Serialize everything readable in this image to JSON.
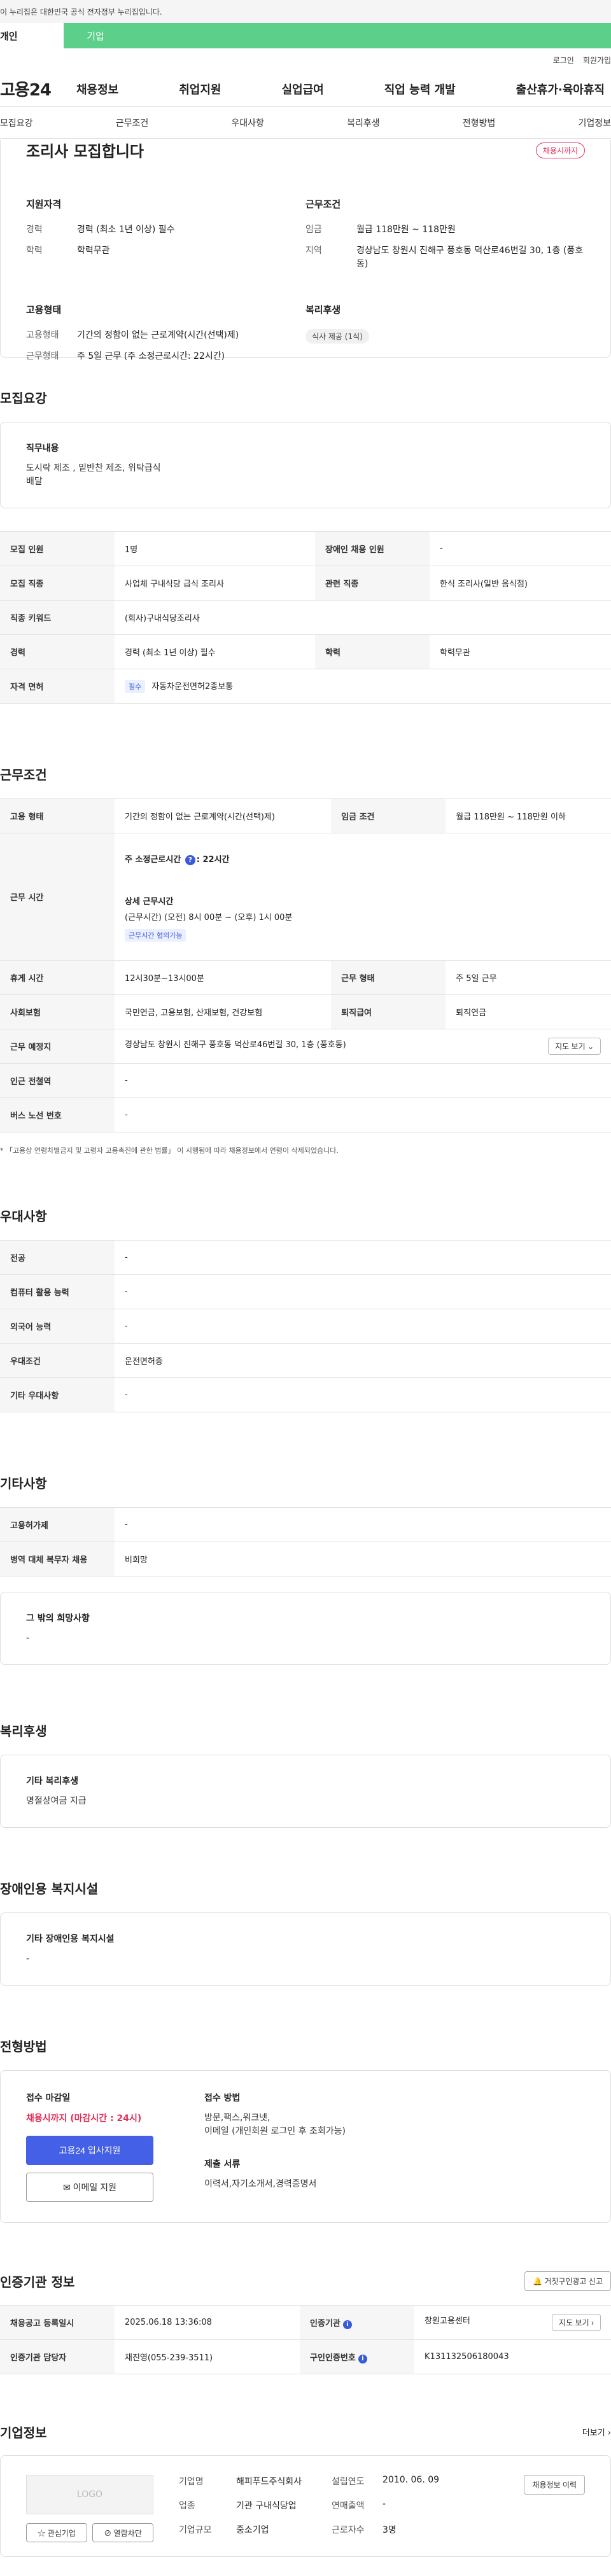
{
  "gov_banner": "이 누리집은 대한민국 공식 전자정부 누리집입니다.",
  "audience_tabs": [
    "개인",
    "기업"
  ],
  "util_links": [
    "로그인",
    "회원가입"
  ],
  "logo": "고용24",
  "gnb": [
    "채용정보",
    "취업지원",
    "실업급여",
    "직업 능력 개발",
    "출산휴가·육아휴직"
  ],
  "subnav": [
    "모집요강",
    "근무조건",
    "우대사항",
    "복리후생",
    "전형방법",
    "기업정보"
  ],
  "hero": {
    "title": "조리사 모집합니다",
    "deadline_badge": "채용시까지",
    "qual_title": "지원자격",
    "qual": [
      {
        "k": "경력",
        "v": "경력 (최소 1년 이상) 필수"
      },
      {
        "k": "학력",
        "v": "학력무관"
      }
    ],
    "cond_title": "근무조건",
    "cond": [
      {
        "k": "임금",
        "v": "월급 118만원 ~ 118만원"
      },
      {
        "k": "지역",
        "v": "경상남도 창원시 진해구 풍호동 덕산로46번길 30, 1층 (풍호동)"
      }
    ],
    "emp_title": "고용형태",
    "emp": [
      {
        "k": "고용형태",
        "v": "기간의 정함이 없는 근로계약(시간(선택)제)"
      },
      {
        "k": "근무형태",
        "v": "주 5일 근무 (주 소정근로시간: 22시간)"
      }
    ],
    "welfare_title": "복리후생",
    "welfare_tag": "식사 제공 (1식)"
  },
  "recruit": {
    "section_title": "모집요강",
    "job_label": "직무내용",
    "job_text1": "도시락 제조 , 밑반찬 제조, 위탁급식",
    "job_text2": "배달",
    "rows": {
      "r1": [
        "모집 인원",
        "1명",
        "장애인 채용 인원",
        "-"
      ],
      "r2": [
        "모집 직종",
        "사업체 구내식당 급식 조리사",
        "관련 직종",
        "한식 조리사(일반 음식점)"
      ],
      "r3": [
        "직종 키워드",
        "(회사)구내식당조리사"
      ],
      "r4": [
        "경력",
        "경력 (최소 1년 이상) 필수",
        "학력",
        "학력무관"
      ],
      "r5": [
        "자격 면허",
        "필수",
        "자동차운전면허2종보통"
      ]
    }
  },
  "work": {
    "section_title": "근무조건",
    "r1": [
      "고용 형태",
      "기간의 정함이 없는 근로계약(시간(선택)제)",
      "임금 조건",
      "월급 118만원 ~ 118만원 이하"
    ],
    "r2_label": "근무 시간",
    "weekly_label": "주 소정근로시간",
    "weekly_value": ": 22시간",
    "detail_label": "상세 근무시간",
    "detail_value": "(근무시간) (오전) 8시 00분 ~ (오후) 1시 00분",
    "detail_tag": "근무시간 협의가능",
    "r3": [
      "휴게 시간",
      "12시30분~13시00분",
      "근무 형태",
      "주 5일 근무"
    ],
    "r4": [
      "사회보험",
      "국민연금, 고용보험, 산재보험, 건강보험",
      "퇴직급여",
      "퇴직연금"
    ],
    "r5": [
      "근무 예정지",
      "경상남도 창원시 진해구 풍호동 덕산로46번길 30, 1층 (풍호동)"
    ],
    "map_btn": "지도 보기 ⌄",
    "r6": [
      "인근 전철역",
      "-"
    ],
    "r7": [
      "버스 노선 번호",
      "-"
    ],
    "note": "* 「고용상 연령차별금지 및 고령자 고용촉진에 관한 법률」 이 시행됨에 따라 채용정보에서 연령이 삭제되었습니다."
  },
  "pref": {
    "section_title": "우대사항",
    "rows": [
      [
        "전공",
        "-"
      ],
      [
        "컴퓨터 활용 능력",
        "-"
      ],
      [
        "외국어 능력",
        "-"
      ],
      [
        "우대조건",
        "운전면허증"
      ],
      [
        "기타 우대사항",
        "-"
      ]
    ]
  },
  "etc": {
    "section_title": "기타사항",
    "rows": [
      [
        "고용허가제",
        "-"
      ],
      [
        "병역 대체 복무자 채용",
        "비희망"
      ]
    ],
    "box_label": "그 밖의 희망사항",
    "box_text": "-"
  },
  "welfare": {
    "section_title": "복리후생",
    "box_label": "기타 복리후생",
    "box_text": "명절상여금 지급"
  },
  "disabled": {
    "section_title": "장애인용 복지시설",
    "box_label": "기타 장애인용 복지시설",
    "box_text": "-"
  },
  "selection": {
    "section_title": "전형방법",
    "deadline_label": "접수 마감일",
    "deadline_value": "채용시까지 (마감시간 : 24시)",
    "apply_btn": "고용24 입사지원",
    "email_btn": "이메일 지원",
    "method_label": "접수 방법",
    "method_text1": "방문,팩스,워크넷,",
    "method_text2": "이메일 (개인회원 로그인 후 조회가능)",
    "docs_label": "제출 서류",
    "docs_text": "이력서,자기소개서,경력증명서"
  },
  "cert": {
    "section_title": "인증기관 정보",
    "report_btn": "거짓구인광고 신고",
    "r1": [
      "채용공고 등록일시",
      "2025.06.18 13:36:08",
      "인증기관",
      "창원고용센터"
    ],
    "map_btn": "지도 보기 ›",
    "r2": [
      "인증기관 담당자",
      "채진영(055-239-3511)",
      "구인인증번호",
      "K131132506180043"
    ]
  },
  "company": {
    "section_title": "기업정보",
    "more": "더보기 ›",
    "logo": "LOGO",
    "fav_btn": "관심기업",
    "block_btn": "열람차단",
    "history_btn": "채용정보 이력",
    "fields": [
      [
        "기업명",
        "해피푸드주식회사",
        "설립연도",
        "2010. 06. 09"
      ],
      [
        "업종",
        "기관 구내식당업",
        "연매출액",
        "-"
      ],
      [
        "기업규모",
        "중소기업",
        "근로자수",
        "3명"
      ]
    ]
  }
}
